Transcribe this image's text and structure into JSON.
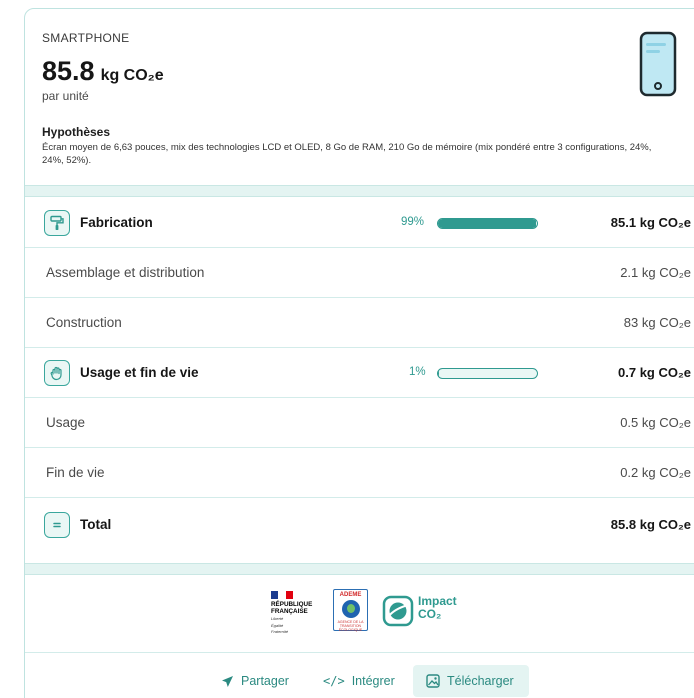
{
  "device": {
    "category": "SMARTPHONE",
    "total_value": "85.8",
    "total_unit": "kg CO₂e",
    "per_unit": "par unité",
    "device_icon": "smartphone-icon"
  },
  "hypotheses": {
    "title": "Hypothèses",
    "text": "Écran moyen de 6,63 pouces, mix des technologies LCD et OLED, 8 Go de RAM, 210 Go de mémoire (mix pondéré entre 3 configurations, 24%, 24%, 52%)."
  },
  "rows": {
    "fabrication": {
      "label": "Fabrication",
      "percent_label": "99%",
      "percent": 0.99,
      "value": "85.1 kg CO₂e",
      "icon": "paint-roller-icon"
    },
    "assemblage": {
      "label": "Assemblage et distribution",
      "value": "2.1 kg CO₂e"
    },
    "construction": {
      "label": "Construction",
      "value": "83 kg CO₂e"
    },
    "usage_fin": {
      "label": "Usage et fin de vie",
      "percent_label": "1%",
      "percent": 0.01,
      "value": "0.7 kg CO₂e",
      "icon": "hand-icon"
    },
    "usage": {
      "label": "Usage",
      "value": "0.5 kg CO₂e"
    },
    "fin_de_vie": {
      "label": "Fin de vie",
      "value": "0.2 kg CO₂e"
    },
    "total": {
      "label": "Total",
      "value": "85.8 kg CO₂e",
      "icon": "equals-icon"
    }
  },
  "logos": {
    "rf_line1": "RÉPUBLIQUE",
    "rf_line2": "FRANÇAISE",
    "rf_motto1": "Liberté",
    "rf_motto2": "Égalité",
    "rf_motto3": "Fraternité",
    "ademe_name": "ADEME",
    "ademe_tagline": "AGENCE DE LA TRANSITION ÉCOLOGIQUE",
    "impact_line1": "Impact",
    "impact_line2": "CO₂"
  },
  "footer": {
    "share_label": "Partager",
    "embed_label": "Intégrer",
    "download_label": "Télécharger"
  },
  "colors": {
    "accent": "#2f9a90",
    "band": "#e4f4f2",
    "border": "#bfe3e0"
  }
}
